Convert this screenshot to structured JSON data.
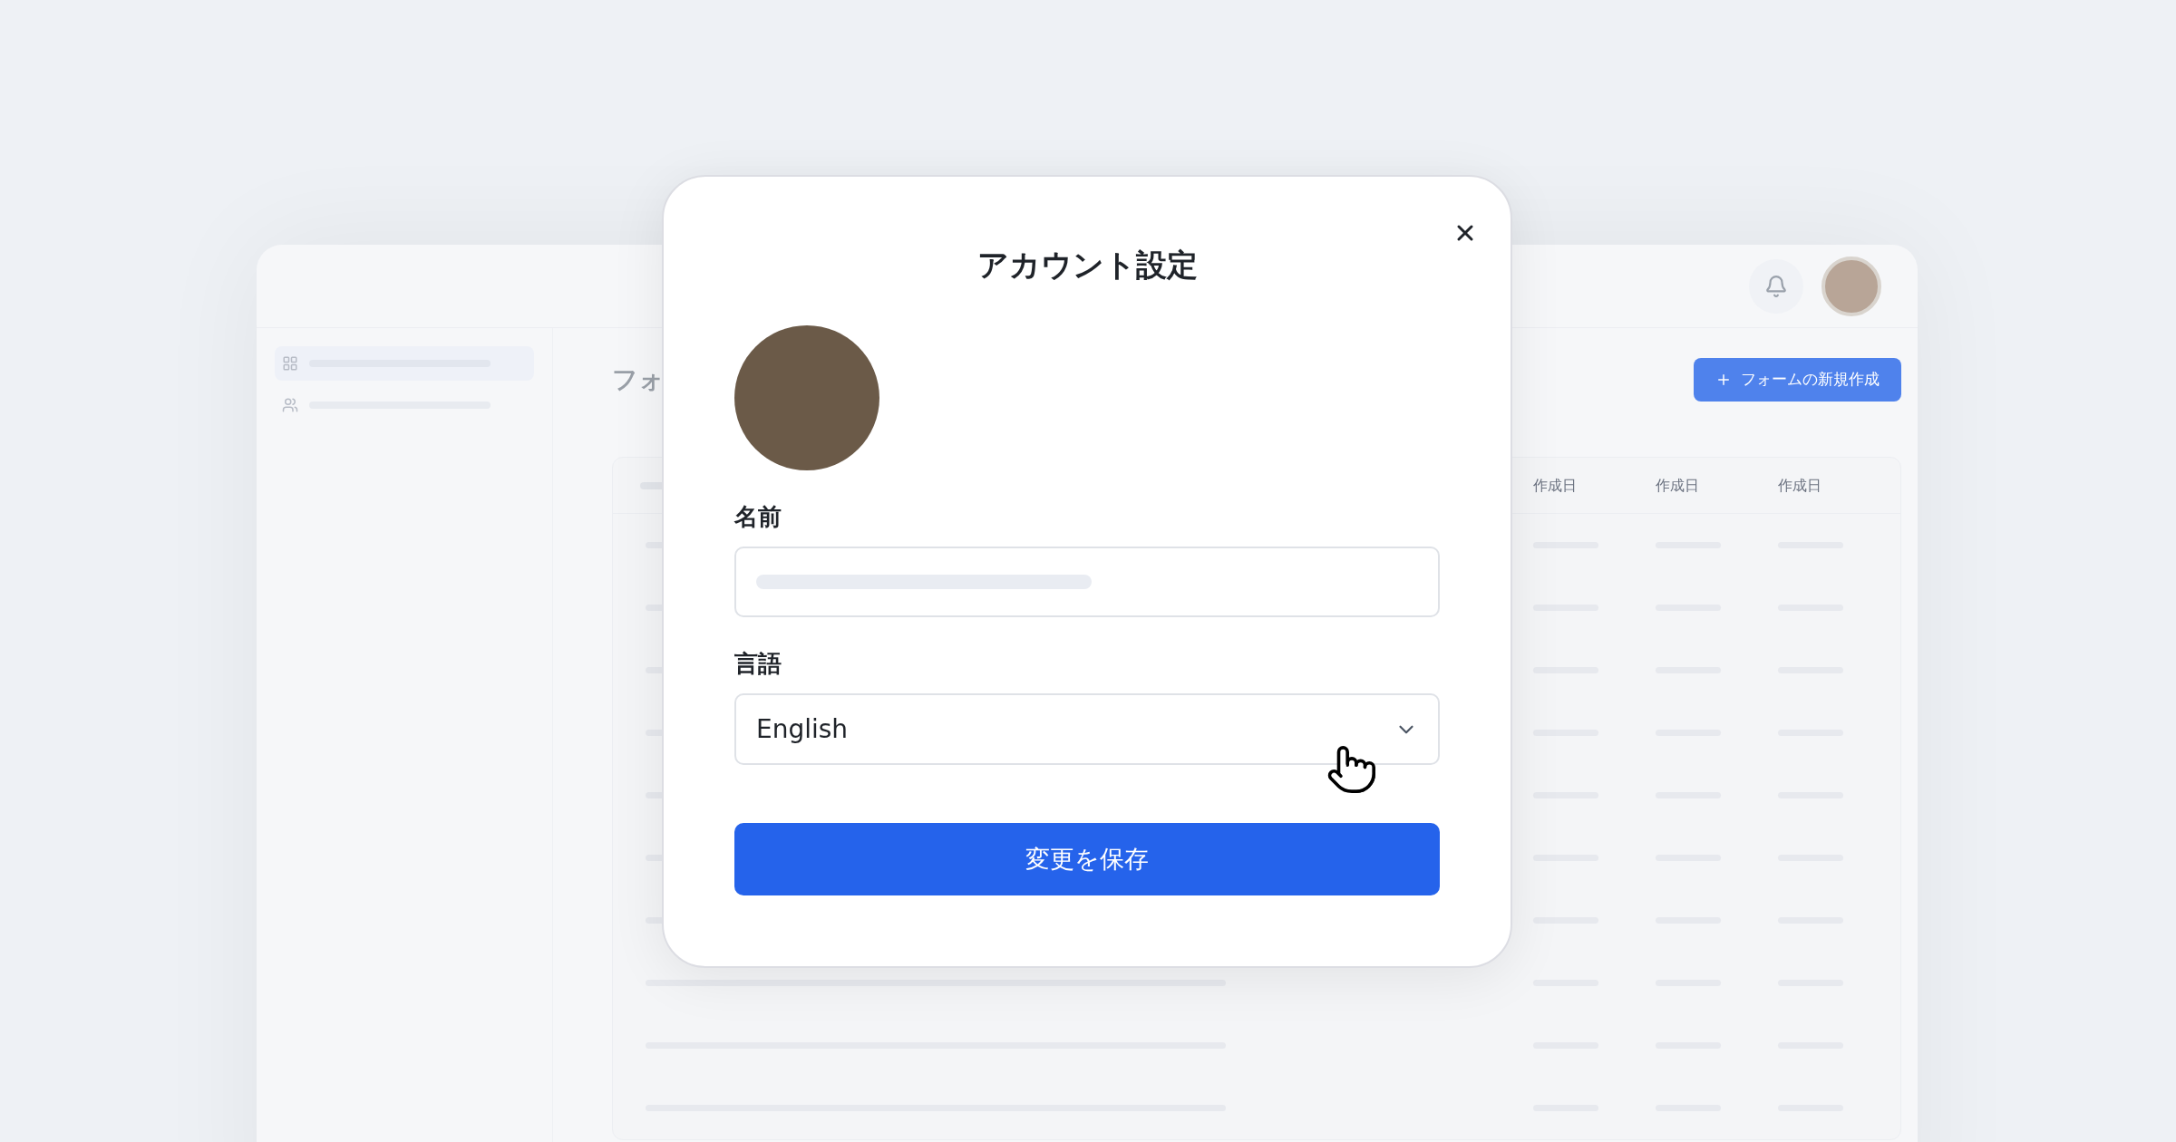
{
  "background": {
    "page_title": "フォ",
    "new_button": {
      "label": "フォームの新規作成"
    },
    "table": {
      "columns": [
        "作成日",
        "作成日",
        "作成日"
      ]
    }
  },
  "dialog": {
    "title": "アカウント設定",
    "fields": [
      {
        "kind": "text",
        "label": "名前"
      },
      {
        "kind": "select",
        "label": "言語",
        "value": "English"
      }
    ],
    "save_button": "変更を保存"
  }
}
